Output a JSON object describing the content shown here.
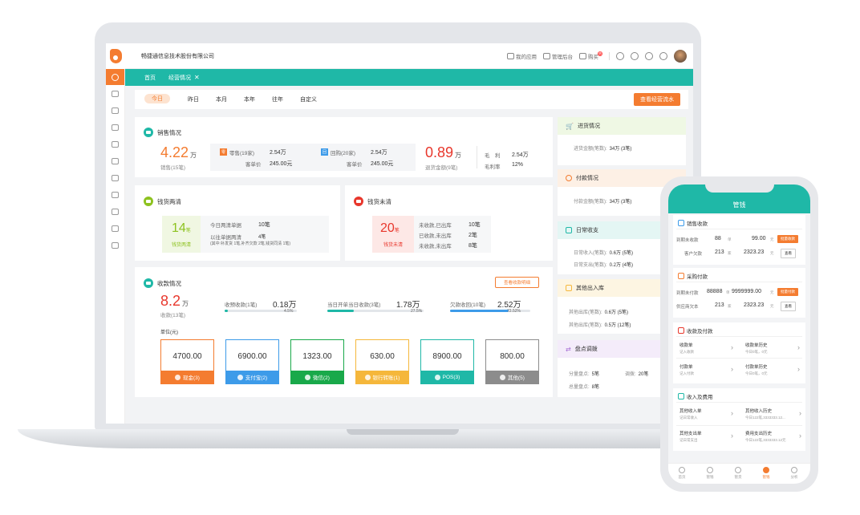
{
  "topbar": {
    "company": "畅捷通信息技术股份有限公司",
    "nav": {
      "apps": "我的应用",
      "admin": "管理后台",
      "buy": "购买",
      "buy_badge": "热"
    }
  },
  "tabs": {
    "home": "首页",
    "current": "经营情况",
    "close": "✕"
  },
  "dates": {
    "items": [
      "今日",
      "昨日",
      "本月",
      "本年",
      "往年",
      "自定义"
    ],
    "selected": "今日",
    "flow_button": "查看经营流水"
  },
  "sales": {
    "title": "销售情况",
    "amount": "4.22",
    "unit": "万",
    "count": "销售(15笔)",
    "retail_tag": "零",
    "retail_label": "零售(19家)",
    "retail_value": "2.54万",
    "retail_avg_label": "客单价",
    "retail_avg": "245.00元",
    "repeat_tag": "回",
    "repeat_label": "回购(20家)",
    "repeat_value": "2.54万",
    "repeat_avg_label": "客单价",
    "repeat_avg": "245.00元",
    "return_amount": "0.89",
    "return_unit": "万",
    "return_label": "退货金额(9笔)",
    "gross_label": "毛　利",
    "gross_value": "2.54万",
    "margin_label": "毛利率",
    "margin_value": "12%"
  },
  "settled": {
    "title": "钱货两清",
    "num": "14",
    "unit": "笔",
    "label": "钱货两清",
    "today_label": "今日两清单据",
    "today_value": "10笔",
    "past_label": "以往单据两清",
    "past_value": "4笔",
    "note": "(其中:补发货 1笔,补齐欠款 2笔,钱货同清 1笔)"
  },
  "unsettled": {
    "title": "钱货未清",
    "num": "20",
    "unit": "笔",
    "label": "钱货未清",
    "r1_label": "未收款,已出库",
    "r1_value": "10笔",
    "r2_label": "已收款,未出库",
    "r2_value": "2笔",
    "r3_label": "未收款,未出库",
    "r3_value": "8笔"
  },
  "receipts": {
    "title": "收款情况",
    "button": "查看收款明细",
    "amount": "8.2",
    "unit": "万",
    "count": "收款(13笔)",
    "m1_label": "收预收款(1笔)",
    "m1_value": "0.18万",
    "m1_pct": "4.5%",
    "m1_fill": 0.045,
    "m2_label": "当日开单当日收款(3笔)",
    "m2_value": "1.78万",
    "m2_pct": "27.5%",
    "m2_fill": 0.275,
    "m3_label": "欠款收回(10笔)",
    "m3_value": "2.52万",
    "m3_pct": "72.52%",
    "m3_fill": 0.7252,
    "unit_label": "单位(元)",
    "tiles": [
      {
        "value": "4700.00",
        "label": "现金(3)",
        "color": "#f47c30"
      },
      {
        "value": "6900.00",
        "label": "支付宝(2)",
        "color": "#3d9be9"
      },
      {
        "value": "1323.00",
        "label": "微信(2)",
        "color": "#19a94a"
      },
      {
        "value": "630.00",
        "label": "银行转账(1)",
        "color": "#f5b73b"
      },
      {
        "value": "8900.00",
        "label": "POS(3)",
        "color": "#1fb8a7"
      },
      {
        "value": "800.00",
        "label": "其他(5)",
        "color": "#8c8c8c"
      }
    ]
  },
  "right": {
    "purchase": {
      "title": "进货情况",
      "line": "进货金额(笔数):",
      "value": "34万 (3笔)"
    },
    "payment": {
      "title": "付款情况",
      "line": "付款金额(笔数):",
      "value": "34万 (3笔)"
    },
    "daily": {
      "title": "日常收支",
      "l1": "日常收入(笔数):",
      "v1": "0.6万 (5笔)",
      "l2": "日常支出(笔数):",
      "v2": "0.2万 (4笔)"
    },
    "other": {
      "title": "其他出入库",
      "l1": "其他出库(笔数):",
      "v1": "0.6万 (5笔)",
      "l2": "其他出库(笔数):",
      "v2": "0.5万 (12笔)"
    },
    "stock": {
      "title": "盘点调拨",
      "l1": "分量盘点:",
      "v1": "5笔",
      "l2": "调拨:",
      "v2": "20笔",
      "l3": "总量盘点:",
      "v3": "8笔"
    }
  },
  "phone": {
    "title": "管钱",
    "sales": {
      "title": "销售收款",
      "r1_label": "到期未收款",
      "r1_num": "88",
      "r1_unit": "单",
      "r1_amt": "99.00",
      "r1_amt_unit": "元",
      "r1_btn": "批量收款",
      "r2_label": "客户欠款",
      "r2_num": "213",
      "r2_unit": "家",
      "r2_amt": "2323.23",
      "r2_amt_unit": "元",
      "r2_btn": "查看"
    },
    "purchase": {
      "title": "采购付款",
      "r1_label": "到期未付款",
      "r1_num": "88888",
      "r1_unit": "单",
      "r1_amt": "9999999.00",
      "r1_amt_unit": "元",
      "r1_btn": "批量付款",
      "r2_label": "供应商欠本",
      "r2_num": "213",
      "r2_unit": "家",
      "r2_amt": "2323.23",
      "r2_amt_unit": "元",
      "r2_btn": "查看"
    },
    "recpay": {
      "title": "收款及付款",
      "a_title": "收款单",
      "a_sub": "记入收款",
      "b_title": "收款单历史",
      "b_sub": "今日0笔，0元",
      "c_title": "付款单",
      "c_sub": "记入付款",
      "d_title": "付款单历史",
      "d_sub": "今日0笔，0元"
    },
    "income": {
      "title": "收入及费用",
      "a_title": "其他收入单",
      "a_sub": "记日常收入",
      "b_title": "其他收入历史",
      "b_sub": "今日122笔,3333333.12...",
      "c_title": "其他支出单",
      "c_sub": "记日常支出",
      "d_title": "费用支出历史",
      "d_sub": "今日122笔,3333333.12元"
    },
    "nav": [
      "首页",
      "管钱",
      "管货",
      "管钱",
      "分析"
    ]
  },
  "colors": {
    "teal": "#1fb8a7",
    "orange": "#f47c30",
    "red": "#e8372c"
  }
}
